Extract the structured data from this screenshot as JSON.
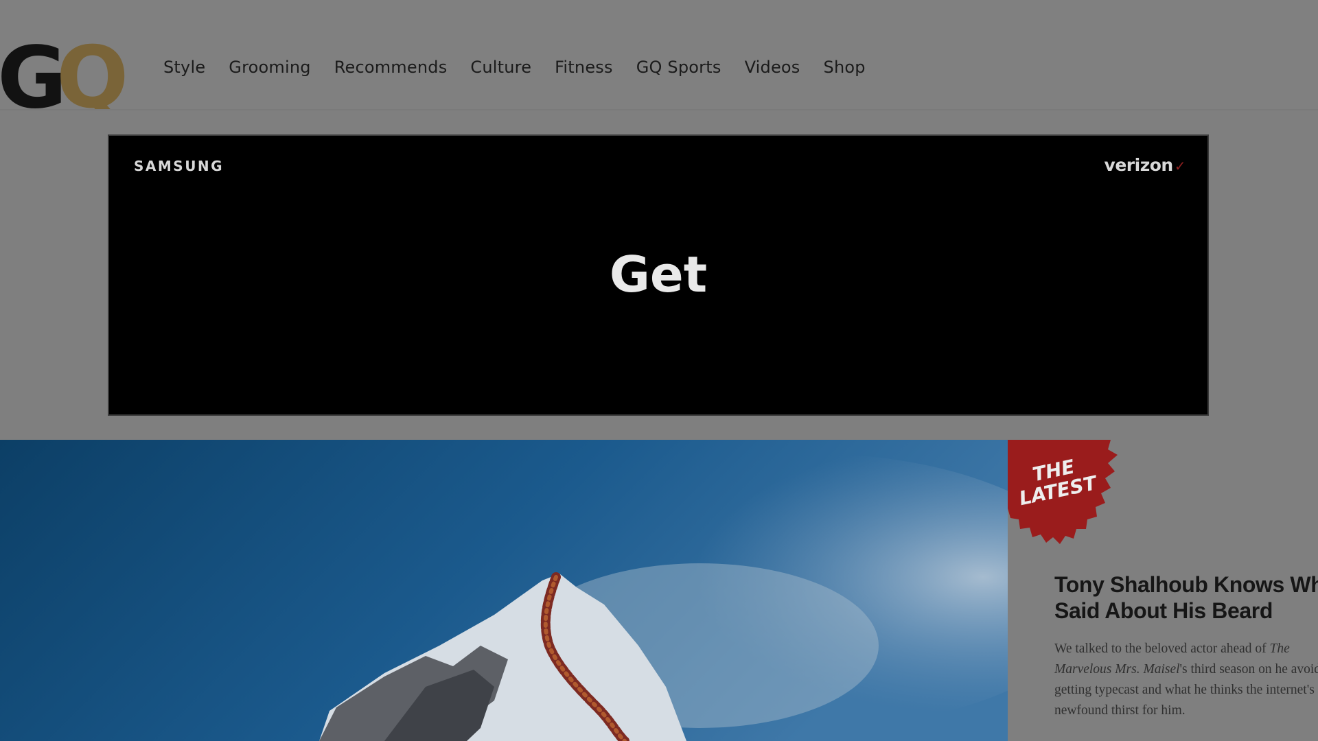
{
  "header": {
    "logo_text": "GQ",
    "nav": [
      "Style",
      "Grooming",
      "Recommends",
      "Culture",
      "Fitness",
      "GQ Sports",
      "Videos",
      "Shop"
    ]
  },
  "ad": {
    "brand": "SAMSUNG",
    "carrier": "verizon",
    "headline": "Get"
  },
  "latest": {
    "badge_line1": "THE",
    "badge_line2": "LATEST",
    "title": "Tony Shalhoub Knows Wha Said About His Beard",
    "dek_part1": "We talked to the beloved actor ahead of ",
    "dek_italic": "The Marvelous Mrs. Maisel",
    "dek_part2": "'s third season on he avoided getting typecast and what he thinks the internet's newfound thirst for him."
  },
  "colors": {
    "overlay_gray": "#808080",
    "ad_background": "#000000",
    "badge_red": "#9a1c1c",
    "logo_gold": "#7a6438"
  }
}
